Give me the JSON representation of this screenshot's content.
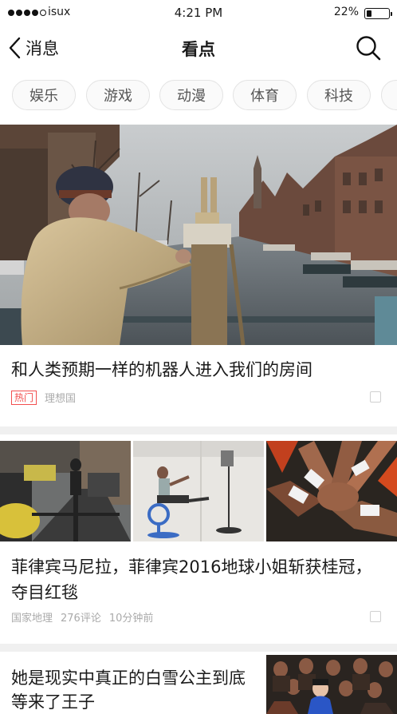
{
  "status_bar": {
    "carrier": "isux",
    "time": "4:21 PM",
    "battery_percent": "22%",
    "battery_level": 0.22,
    "signal_bars_filled": 4,
    "signal_bars_total": 5
  },
  "nav": {
    "back_label": "消息",
    "title": "看点",
    "back_icon": "chevron-left-icon",
    "search_icon": "search-icon"
  },
  "tabs": [
    {
      "label": "娱乐"
    },
    {
      "label": "游戏"
    },
    {
      "label": "动漫"
    },
    {
      "label": "体育"
    },
    {
      "label": "科技"
    },
    {
      "label": ""
    }
  ],
  "feed": {
    "card1": {
      "title": "和人类预期一样的机器人进入我们的房间",
      "tag": "热门",
      "source": "理想国"
    },
    "card2": {
      "title": "菲律宾马尼拉，菲律宾2016地球小姐斩获桂冠，夺目红毯",
      "source": "国家地理",
      "comments": "276评论",
      "time": "10分钟前"
    },
    "card3": {
      "title": "她是现实中真正的白雪公主到底等来了王子"
    }
  },
  "colors": {
    "hot_tag": "#f24e4e",
    "divider": "#f0f0f0",
    "tab_border": "#e3e3e3"
  }
}
